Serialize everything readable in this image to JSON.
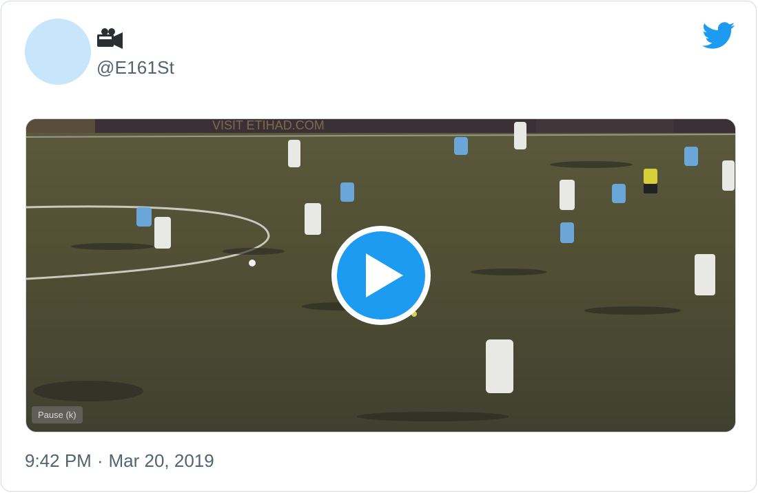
{
  "tweet": {
    "handle": "@E161St",
    "name_emoji": "video-camera-icon",
    "media": {
      "type": "gif",
      "pause_label": "Pause (k)",
      "banner_text": "VISIT ETIHAD.COM",
      "play_icon": "play-icon"
    },
    "time": "9:42 PM",
    "separator": "·",
    "date": "Mar 20, 2019"
  },
  "colors": {
    "accent": "#1d9bf0",
    "avatar_bg": "#c7e5fb",
    "secondary_text": "#536471",
    "border": "#cfd9de"
  }
}
